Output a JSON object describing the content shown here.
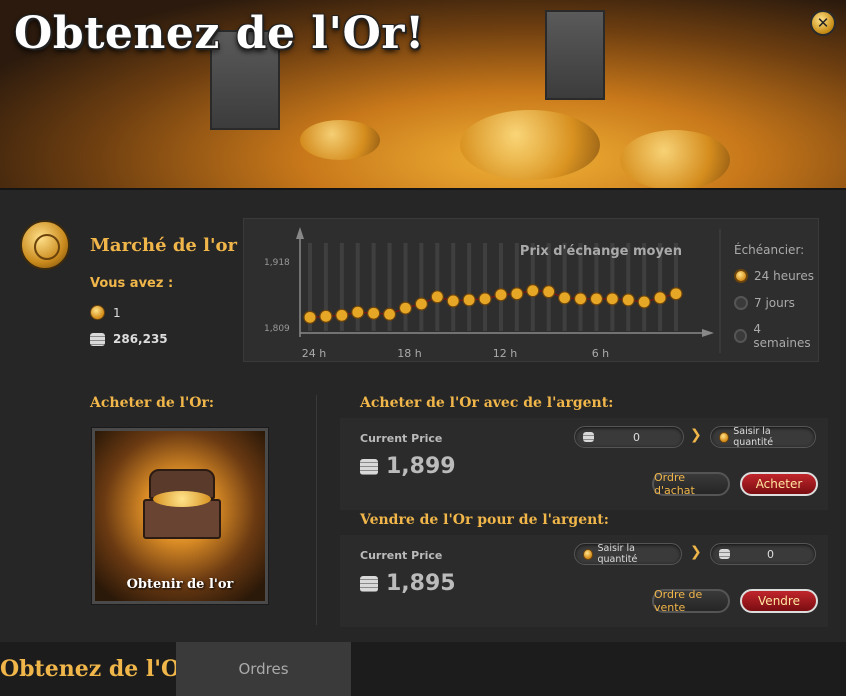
{
  "banner": {
    "title": "Obtenez de l'Or!"
  },
  "market": {
    "title": "Marché de l'or",
    "you_have_label": "Vous avez :",
    "gold_amount": "1",
    "silver_amount": "286,235"
  },
  "chart": {
    "title": "Prix d'échange moyen",
    "timeline_label": "Échéancier:",
    "options": [
      "24 heures",
      "7 jours",
      "4 semaines"
    ],
    "selected_option": "24 heures"
  },
  "chart_data": {
    "type": "line",
    "title": "Prix d'échange moyen",
    "x_tick_labels": [
      "24 h",
      "18 h",
      "12 h",
      "6 h"
    ],
    "y_tick_labels": [
      "1,918",
      "1,809"
    ],
    "ylim": [
      1809,
      1918
    ],
    "values": [
      1820,
      1822,
      1824,
      1830,
      1828,
      1826,
      1838,
      1846,
      1860,
      1852,
      1854,
      1856,
      1864,
      1866,
      1872,
      1870,
      1858,
      1856,
      1856,
      1856,
      1854,
      1850,
      1858,
      1866
    ]
  },
  "buy": {
    "section_title": "Acheter de l'Or:",
    "card_label": "Obtenir de l'or",
    "with_silver_title": "Acheter de l'Or avec de l'argent:",
    "price_label": "Current Price",
    "price_value": "1,899",
    "silver_input": "0",
    "quantity_placeholder": "Saisir la quantité",
    "order_button": "Ordre d'achat",
    "action_button": "Acheter"
  },
  "sell": {
    "title": "Vendre de l'Or pour de l'argent:",
    "price_label": "Current Price",
    "price_value": "1,895",
    "quantity_placeholder": "Saisir la quantité",
    "silver_output": "0",
    "order_button": "Ordre de vente",
    "action_button": "Vendre"
  },
  "tabs": [
    "Obtenez de l'Or",
    "Ordres"
  ],
  "colors": {
    "accent_gold": "#f0b64a",
    "action_red": "#c0262c"
  }
}
